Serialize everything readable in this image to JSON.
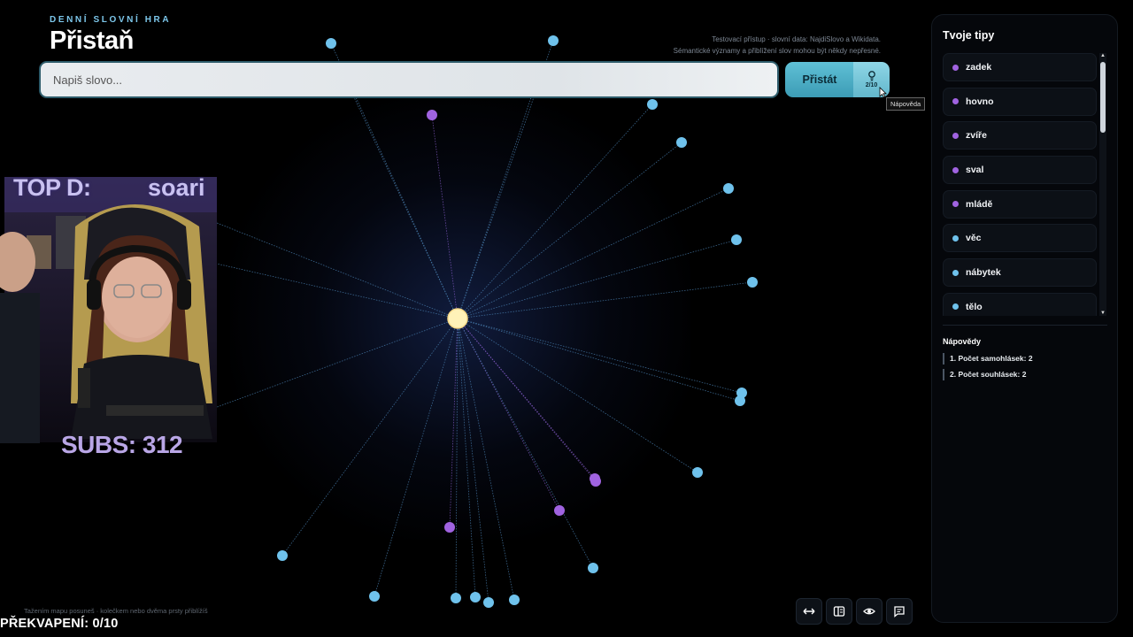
{
  "header": {
    "subtitle": "DENNÍ SLOVNÍ HRA",
    "title": "Přistaň",
    "info_line1": "Testovací přístup · slovní data: NajdiSlovo a Wikidata.",
    "info_line2": "Sémantické významy a přiblížení slov mohou být někdy nepřesné."
  },
  "search": {
    "placeholder": "Napiš slovo...",
    "value": ""
  },
  "submit_label": "Přistát",
  "hint_button": {
    "count": "2/10",
    "tooltip": "Nápověda",
    "icon": "lightbulb-icon"
  },
  "footer_note": "Tažením mapu posuneš · kolečkem nebo dvěma prsty přiblížíš",
  "overlap_label": "PŘEKVAPENÍ: 0/10",
  "toolbar_icons": [
    "arrows-horizontal-icon",
    "panel-layout-icon",
    "eye-icon",
    "comment-icon"
  ],
  "webcam": {
    "top_label": "TOP D:",
    "top_name": "soari",
    "subs_label": "SUBS: 312"
  },
  "panel": {
    "title": "Tvoje tipy",
    "guesses": [
      {
        "word": "zadek",
        "color": "#a063e0"
      },
      {
        "word": "hovno",
        "color": "#a063e0"
      },
      {
        "word": "zvíře",
        "color": "#a063e0"
      },
      {
        "word": "sval",
        "color": "#a063e0"
      },
      {
        "word": "mládě",
        "color": "#a063e0"
      },
      {
        "word": "věc",
        "color": "#6fc2ec"
      },
      {
        "word": "nábytek",
        "color": "#6fc2ec"
      },
      {
        "word": "tělo",
        "color": "#6fc2ec"
      }
    ],
    "hints_title": "Nápovědy",
    "hints": [
      "1. Počet samohlásek: 2",
      "2. Počet souhlásek: 2"
    ]
  },
  "colors": {
    "center": "#fff2b8",
    "node_blue": "#6fc2ec",
    "node_purple": "#a063e0",
    "accent": "#4fb3cc"
  }
}
